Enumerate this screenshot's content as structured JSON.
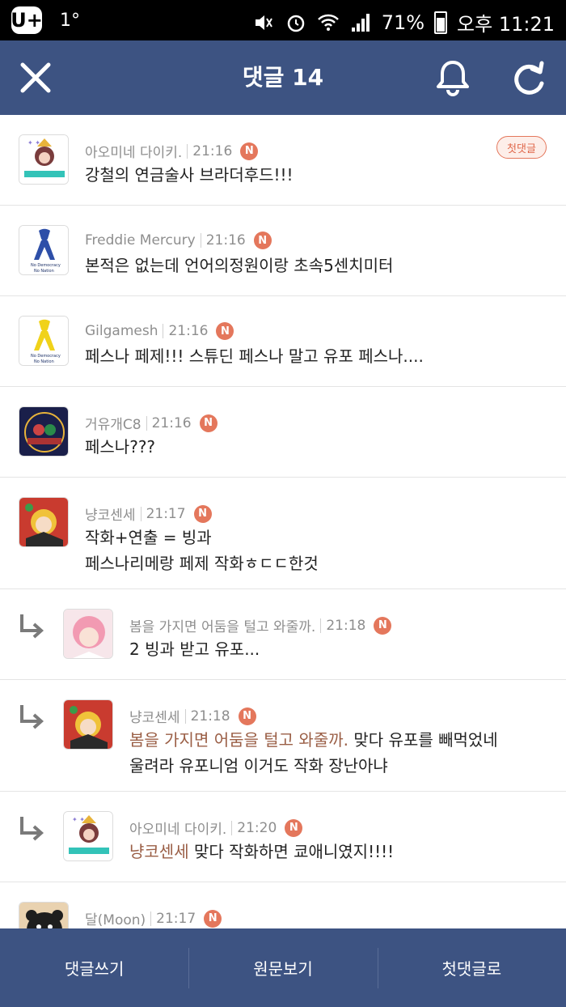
{
  "status_bar": {
    "logo": "U+",
    "temperature": "1°",
    "battery": "71%",
    "time": "오후 11:21"
  },
  "header": {
    "title": "댓글 14"
  },
  "comments": [
    {
      "author": "아오미네 다이키.",
      "time": "21:16",
      "badge": "N",
      "text": "강철의 연금술사 브라더후드!!!",
      "tag": "첫댓글"
    },
    {
      "author": "Freddie Mercury",
      "time": "21:16",
      "badge": "N",
      "text": "본적은 없는데 언어의정원이랑 초속5센치미터"
    },
    {
      "author": "Gilgamesh",
      "time": "21:16",
      "badge": "N",
      "text": "페스나 페제!!! 스튜딘 페스나 말고 유포 페스나...."
    },
    {
      "author": "거유개C8",
      "time": "21:16",
      "badge": "N",
      "text": "페스나???"
    },
    {
      "author": "냥코센세",
      "time": "21:17",
      "badge": "N",
      "line1": "작화+연출 = 빙과",
      "line2": "페스나리메랑 페제 작화ㅎㄷㄷ한것"
    },
    {
      "author": "봄을 가지면 어둠을 털고 와줄까.",
      "time": "21:18",
      "badge": "N",
      "text": "2 빙과 받고 유포..."
    },
    {
      "author": "냥코센세",
      "time": "21:18",
      "badge": "N",
      "mention": "봄을 가지면 어둠을 털고 와줄까.",
      "line1": " 맞다 유포를 빼먹었네",
      "line2": "울려라 유포니엄 이거도 작화 장난아냐"
    },
    {
      "author": "아오미네 다이키.",
      "time": "21:20",
      "badge": "N",
      "mention": "냥코센세",
      "text": " 맞다 작화하면 쿄애니였지!!!!"
    },
    {
      "author": "달(Moon)",
      "time": "21:17",
      "badge": "N"
    }
  ],
  "bottom_bar": {
    "write": "댓글쓰기",
    "original": "원문보기",
    "first": "첫댓글로"
  },
  "colors": {
    "header_bg": "#3d5382",
    "new_badge": "#e4775c",
    "mention": "#9a5e45"
  }
}
